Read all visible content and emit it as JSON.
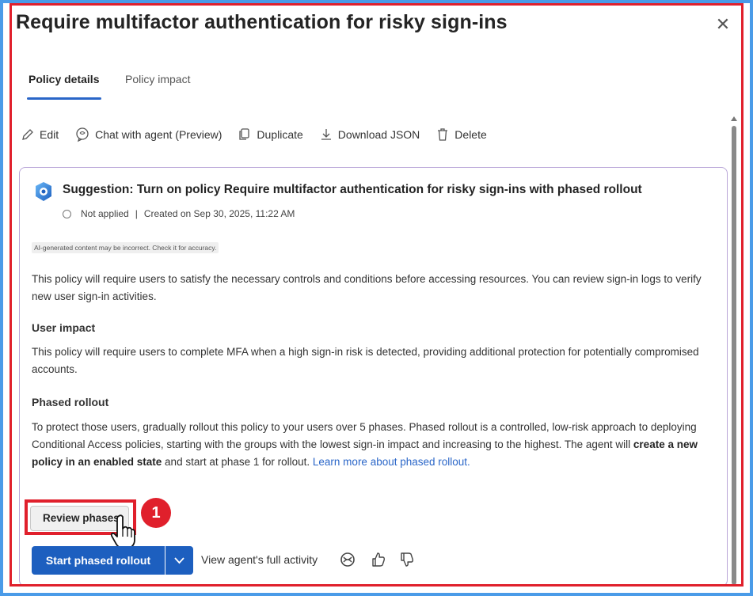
{
  "panel": {
    "title": "Require multifactor authentication for risky sign-ins",
    "close_icon": "close-icon"
  },
  "tabs": [
    {
      "label": "Policy details",
      "active": true
    },
    {
      "label": "Policy impact",
      "active": false
    }
  ],
  "toolbar": {
    "edit": "Edit",
    "chat": "Chat with agent (Preview)",
    "duplicate": "Duplicate",
    "download": "Download JSON",
    "delete": "Delete"
  },
  "suggestion": {
    "title": "Suggestion: Turn on policy Require multifactor authentication for risky sign-ins with phased rollout",
    "status": "Not applied",
    "separator": "|",
    "created": "Created on Sep 30, 2025, 11:22 AM",
    "ai_notice": "AI-generated content may be incorrect. Check it for accuracy.",
    "intro": "This policy will require users to satisfy the necessary controls and conditions before accessing resources. You can review sign-in logs to verify new user sign-in activities.",
    "user_impact_heading": "User impact",
    "user_impact_text": "This policy will require users to complete MFA when a high sign-in risk is detected, providing additional protection for potentially compromised accounts.",
    "phased_heading": "Phased rollout",
    "phased_text_1": "To protect those users, gradually rollout this policy to your users over 5 phases. Phased rollout is a controlled, low-risk approach to deploying Conditional Access policies, starting with the groups with the lowest sign-in impact and increasing to the highest. The agent will ",
    "phased_bold": "create a new policy in an enabled state",
    "phased_text_2": " and start at phase 1 for rollout. ",
    "learn_more": "Learn more about phased rollout.",
    "review_button": "Review phases",
    "start_button": "Start phased rollout",
    "view_activity": "View agent's full activity"
  },
  "annotation": {
    "step_number": "1",
    "highlight_color": "#e0202c"
  },
  "colors": {
    "accent": "#1d5fbf",
    "link": "#2a66c8",
    "background_frame": "#4a9be8",
    "card_border": "#b9a6d8"
  }
}
